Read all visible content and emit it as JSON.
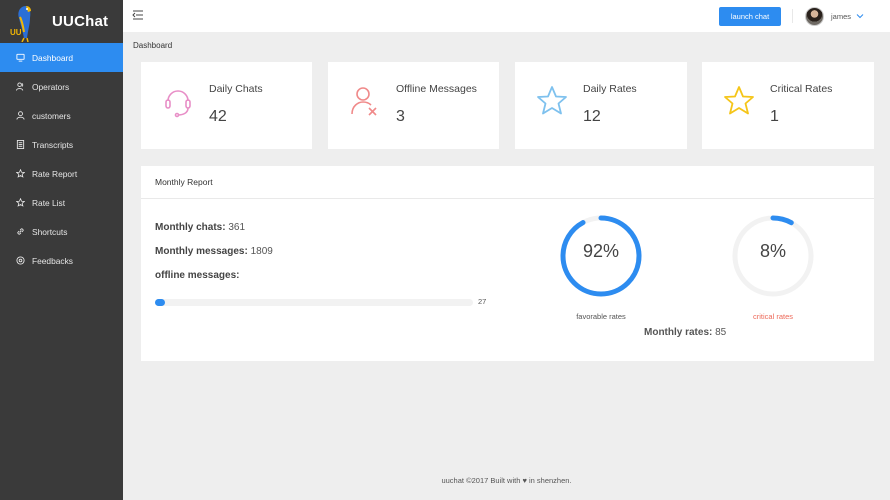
{
  "app": {
    "name": "UUChat",
    "logo_text": "UU"
  },
  "sidebar": {
    "items": [
      {
        "label": "Dashboard",
        "icon": "monitor-icon",
        "active": true
      },
      {
        "label": "Operators",
        "icon": "users-icon",
        "active": false
      },
      {
        "label": "customers",
        "icon": "person-icon",
        "active": false
      },
      {
        "label": "Transcripts",
        "icon": "document-icon",
        "active": false
      },
      {
        "label": "Rate Report",
        "icon": "star-icon",
        "active": false
      },
      {
        "label": "Rate List",
        "icon": "star-outline-icon",
        "active": false
      },
      {
        "label": "Shortcuts",
        "icon": "link-icon",
        "active": false
      },
      {
        "label": "Feedbacks",
        "icon": "feedback-icon",
        "active": false
      }
    ]
  },
  "header": {
    "launch_label": "launch chat",
    "user_name": "james"
  },
  "breadcrumb": "Dashboard",
  "cards": [
    {
      "label": "Daily Chats",
      "value": "42",
      "icon": "headset-icon",
      "color": "#e88fc7"
    },
    {
      "label": "Offline Messages",
      "value": "3",
      "icon": "user-offline-icon",
      "color": "#f08a8a"
    },
    {
      "label": "Daily Rates",
      "value": "12",
      "icon": "star-icon",
      "color": "#7ec1ee"
    },
    {
      "label": "Critical Rates",
      "value": "1",
      "icon": "star-icon",
      "color": "#f5c518"
    }
  ],
  "report": {
    "title": "Monthly Report",
    "chats_label": "Monthly chats:",
    "chats_value": "361",
    "messages_label": "Monthly messages:",
    "messages_value": "1809",
    "offline_label": "offline messages:",
    "offline_value": "27",
    "offline_fraction": 0.03,
    "favorable": {
      "text": "92%",
      "percent": 92,
      "caption": "favorable rates",
      "color": "#2d8cf0",
      "caption_color": "#555555"
    },
    "critical": {
      "text": "8%",
      "percent": 8,
      "caption": "critical rates",
      "color": "#2d8cf0",
      "caption_color": "#ed6a5a"
    },
    "rates_label": "Monthly rates:",
    "rates_value": "85"
  },
  "footer": {
    "text": "uuchat ©2017 Built with ♥ in shenzhen."
  },
  "colors": {
    "accent": "#2d8cf0",
    "sidebar_bg": "#3a3a3a",
    "page_bg": "#eeeeee"
  }
}
